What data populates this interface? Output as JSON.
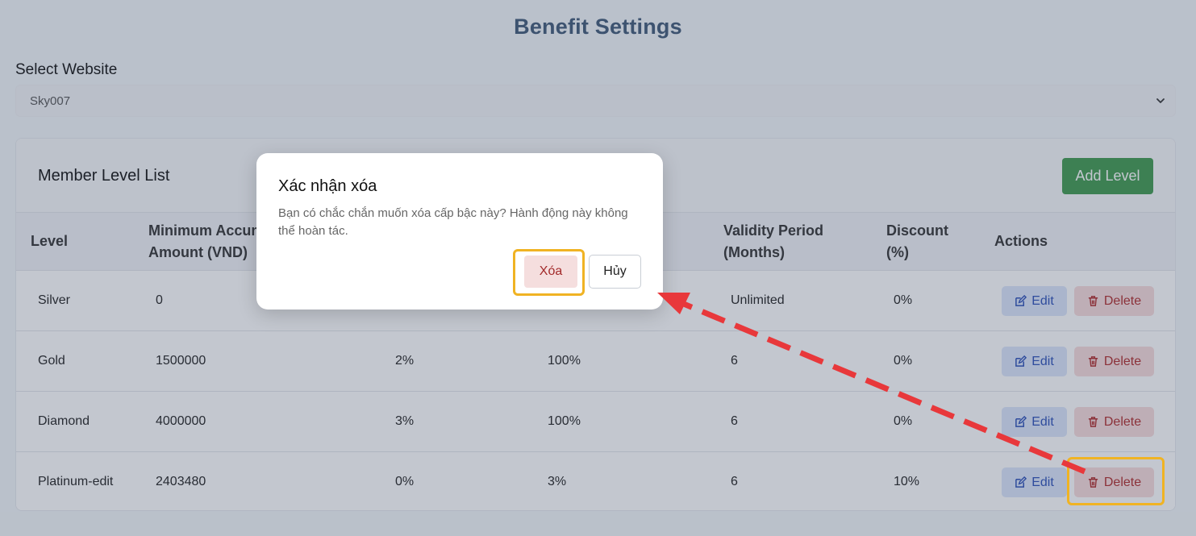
{
  "page": {
    "title": "Benefit Settings",
    "select_label": "Select Website",
    "select_value": "Sky007"
  },
  "card": {
    "title": "Member Level List",
    "add_button": "Add Level"
  },
  "table": {
    "headers": [
      "Level",
      "Minimum Accumulated Amount (VND)",
      "",
      "",
      "Validity Period (Months)",
      "Discount (%)",
      "Actions"
    ],
    "header_visible": {
      "min_amount_line1": "Minimum Accum",
      "min_amount_line2": "Amount (VND)",
      "validity_line1": "Validity Period",
      "validity_line2": "(Months)",
      "discount_line1": "Discount",
      "discount_line2": "(%)"
    },
    "rows": [
      {
        "level": "Silver",
        "min_amount": "0",
        "col3": "",
        "col4": "",
        "validity": "Unlimited",
        "discount": "0%"
      },
      {
        "level": "Gold",
        "min_amount": "1500000",
        "col3": "2%",
        "col4": "100%",
        "validity": "6",
        "discount": "0%"
      },
      {
        "level": "Diamond",
        "min_amount": "4000000",
        "col3": "3%",
        "col4": "100%",
        "validity": "6",
        "discount": "0%"
      },
      {
        "level": "Platinum-edit",
        "min_amount": "2403480",
        "col3": "0%",
        "col4": "3%",
        "validity": "6",
        "discount": "10%"
      }
    ],
    "edit_label": "Edit",
    "delete_label": "Delete"
  },
  "modal": {
    "title": "Xác nhận xóa",
    "message": "Bạn có chắc chắn muốn xóa cấp bậc này? Hành động này không thể hoàn tác.",
    "confirm_label": "Xóa",
    "cancel_label": "Hủy"
  },
  "colors": {
    "accent_green": "#3f9a4e",
    "edit_blue": "#2b4fb8",
    "delete_red": "#b02a2a",
    "highlight": "#f0b323",
    "annotation_arrow": "#e8383b"
  },
  "icons": {
    "edit": "pencil-square-icon",
    "delete": "trash-icon",
    "select": "chevron-down-icon"
  }
}
